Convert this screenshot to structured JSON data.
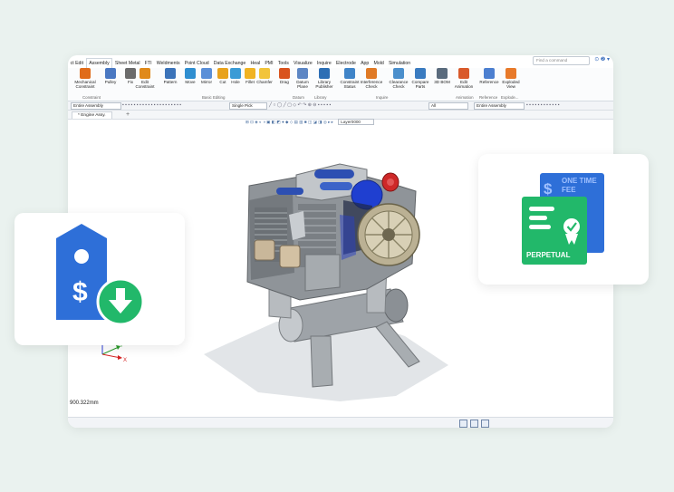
{
  "menu": {
    "items": [
      "ct Edit",
      "Assembly",
      "Sheet Metal",
      "FTI",
      "Weldments",
      "Point Cloud",
      "Data Exchange",
      "Heal",
      "PMI",
      "Tools",
      "Visualize",
      "Inquire",
      "Electrode",
      "App",
      "Mold",
      "Simulation"
    ],
    "active_index": 1,
    "search_placeholder": "Find a command"
  },
  "ribbon": {
    "buttons": [
      {
        "label": "Mechanical\nConstraint",
        "color": "#e06c1a"
      },
      {
        "label": "Pulley",
        "color": "#4a78c2"
      },
      {
        "label": "Fix",
        "color": "#6b6b6b"
      },
      {
        "label": "Edit\nConstraint",
        "color": "#e08a1a"
      },
      {
        "label": "Pattern",
        "color": "#3b73b9"
      },
      {
        "label": "Move",
        "color": "#2f8ed0"
      },
      {
        "label": "Mirror",
        "color": "#5a8fd8"
      },
      {
        "label": "Cut",
        "color": "#e8a21c"
      },
      {
        "label": "Hole",
        "color": "#3a9bd6"
      },
      {
        "label": "Fillet",
        "color": "#f0b323"
      },
      {
        "label": "Chamfer",
        "color": "#f2c43a"
      },
      {
        "label": "Drag",
        "color": "#d9531e"
      },
      {
        "label": "Datum\nPlane",
        "color": "#5d86c4"
      },
      {
        "label": "Library\nPublisher",
        "color": "#2d6fb5"
      },
      {
        "label": "Constraint\nStatus",
        "color": "#3f84c8"
      },
      {
        "label": "Interference\nCheck",
        "color": "#e07a26"
      },
      {
        "label": "Clearance\nCheck",
        "color": "#4b8fcc"
      },
      {
        "label": "Compare\nParts",
        "color": "#3a7bc0"
      },
      {
        "label": "3D BOM",
        "color": "#5a6b7d"
      },
      {
        "label": "Edit\nAnimation",
        "color": "#d95a2b"
      },
      {
        "label": "Reference",
        "color": "#4c7fd0"
      },
      {
        "label": "Exploded\nView",
        "color": "#e87a2a"
      }
    ],
    "groups": [
      "Constraint",
      "Basic Editing",
      "Datum",
      "Library",
      "Inquire",
      "Animation",
      "Reference",
      "Explode..."
    ]
  },
  "toolbar": {
    "filter_left": "Entire Assembly",
    "pick": "Single Pick",
    "filter_all": "All",
    "filter_right": "Entire Assembly"
  },
  "tabs": {
    "document": "* Engine Assy.",
    "add": "+"
  },
  "view_toolbar": {
    "layer": "Layer0000"
  },
  "viewport": {
    "measure": "900.322mm",
    "axes": {
      "x": "X",
      "y": "Y",
      "z": "Z"
    }
  },
  "badges": {
    "one_time_fee_line1": "ONE TIME",
    "one_time_fee_line2": "FEE",
    "perpetual": "PERPETUAL",
    "dollar": "$"
  },
  "colors": {
    "blue": "#2e6fd8",
    "green": "#22b86a",
    "page_bg": "#eaf2ef"
  }
}
